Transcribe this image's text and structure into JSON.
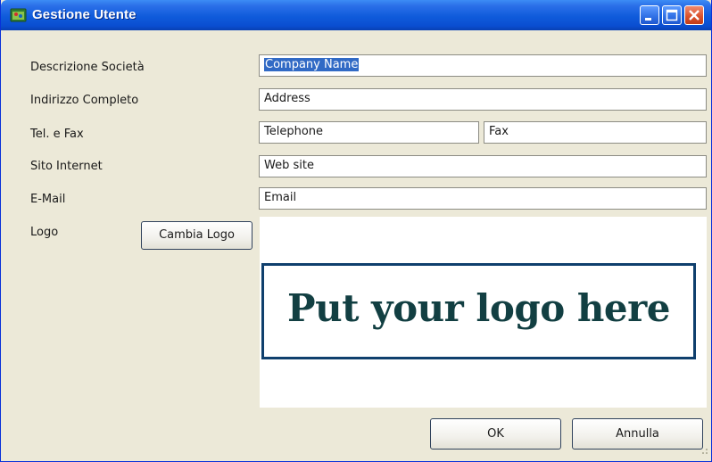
{
  "window": {
    "title": "Gestione Utente",
    "icon": "user-management-icon"
  },
  "form": {
    "company_label": "Descrizione Società",
    "company_value": "Company Name",
    "address_label": "Indirizzo Completo",
    "address_value": "Address",
    "phone_fax_label": "Tel. e Fax",
    "phone_value": "Telephone",
    "fax_value": "Fax",
    "website_label": "Sito Internet",
    "website_value": "Web site",
    "email_label": "E-Mail",
    "email_value": "Email",
    "logo_label": "Logo",
    "change_logo_label": "Cambia Logo",
    "logo_text": "Put your logo here"
  },
  "buttons": {
    "ok_label": "OK",
    "cancel_label": "Annulla"
  },
  "colors": {
    "titlebar": "#0a4ed1",
    "selection": "#316ac5",
    "logo_border": "#0f3f6d",
    "logo_text": "#123f42"
  }
}
